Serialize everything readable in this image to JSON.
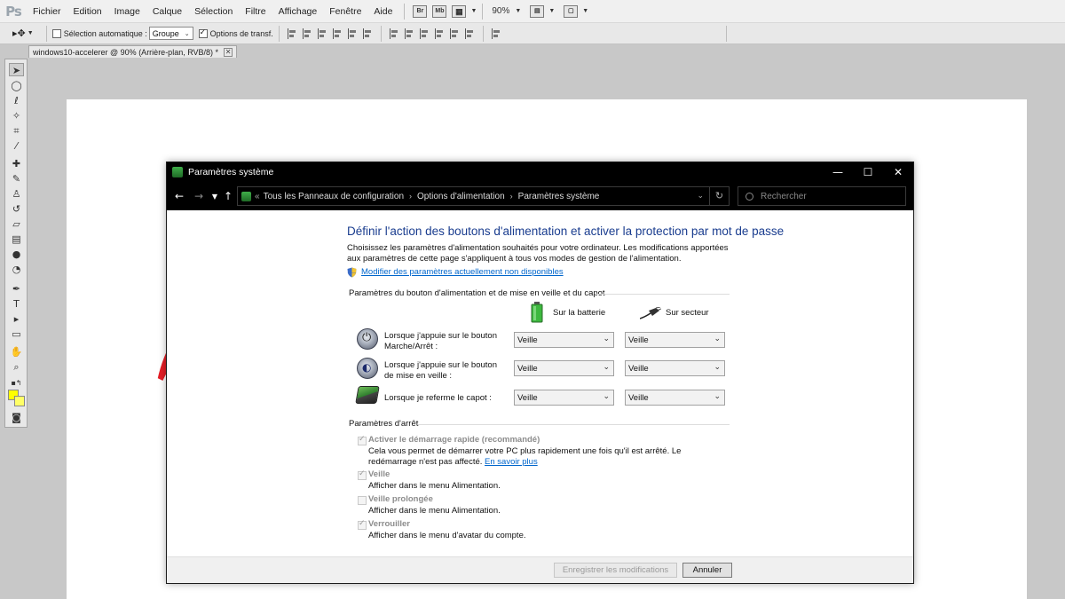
{
  "app": {
    "logo": "Ps",
    "menu": [
      "Fichier",
      "Edition",
      "Image",
      "Calque",
      "Sélection",
      "Filtre",
      "Affichage",
      "Fenêtre",
      "Aide"
    ],
    "toolbar_icons": [
      "Br",
      "Mb"
    ],
    "zoom": "90%"
  },
  "options_bar": {
    "auto_select_label": "Sélection automatique :",
    "auto_select_checked": false,
    "auto_select_value": "Groupe",
    "transform_label": "Options de transf.",
    "transform_checked": true
  },
  "document_tab": {
    "title": "windows10-accelerer @ 90% (Arrière-plan, RVB/8) *",
    "close": "✕"
  },
  "tools": [
    "move-icon",
    "marquee-icon",
    "lasso-icon",
    "quick-select-icon",
    "crop-icon",
    "eyedropper-icon",
    "healing-icon",
    "brush-icon",
    "clone-stamp-icon",
    "history-brush-icon",
    "eraser-icon",
    "gradient-icon",
    "blur-icon",
    "dodge-icon",
    "pen-icon",
    "type-icon",
    "path-select-icon",
    "shape-icon",
    "hand-icon",
    "zoom-icon"
  ],
  "colors": {
    "foreground": "#ffff00",
    "background": "#ffff66",
    "arrow": "#e41e26",
    "heading": "#1a3d8f",
    "link": "#0066cc"
  },
  "dialog": {
    "title": "Paramètres système",
    "controls": {
      "minimize": "—",
      "maximize": "☐",
      "close": "✕"
    },
    "breadcrumb": [
      "Tous les Panneaux de configuration",
      "Options d'alimentation",
      "Paramètres système"
    ],
    "breadcrumb_prefix": "«",
    "search_placeholder": "Rechercher",
    "heading": "Définir l'action des boutons d'alimentation et activer la protection par mot de passe",
    "description": "Choisissez les paramètres d'alimentation souhaités pour votre ordinateur. Les modifications apportées aux paramètres de cette page s'appliquent à tous vos modes de gestion de l'alimentation.",
    "modify_link": "Modifier des paramètres actuellement non disponibles",
    "section_buttons": "Paramètres du bouton d'alimentation et de mise en veille et du capot",
    "col_battery": "Sur la batterie",
    "col_plugged": "Sur secteur",
    "rows": [
      {
        "label": "Lorsque j'appuie sur le bouton Marche/Arrêt :",
        "battery": "Veille",
        "plugged": "Veille"
      },
      {
        "label": "Lorsque j'appuie sur le bouton de mise en veille :",
        "battery": "Veille",
        "plugged": "Veille"
      },
      {
        "label": "Lorsque je referme le capot :",
        "battery": "Veille",
        "plugged": "Veille"
      }
    ],
    "section_shutdown": "Paramètres d'arrêt",
    "shutdown_options": [
      {
        "label": "Activer le démarrage rapide (recommandé)",
        "checked": true,
        "desc": "Cela vous permet de démarrer votre PC plus rapidement une fois qu'il est arrêté. Le redémarrage n'est pas affecté.",
        "link": "En savoir plus"
      },
      {
        "label": "Veille",
        "checked": true,
        "desc": "Afficher dans le menu Alimentation."
      },
      {
        "label": "Veille prolongée",
        "checked": false,
        "desc": "Afficher dans le menu Alimentation."
      },
      {
        "label": "Verrouiller",
        "checked": true,
        "desc": "Afficher dans le menu d'avatar du compte."
      }
    ],
    "save_button": "Enregistrer les modifications",
    "cancel_button": "Annuler"
  }
}
